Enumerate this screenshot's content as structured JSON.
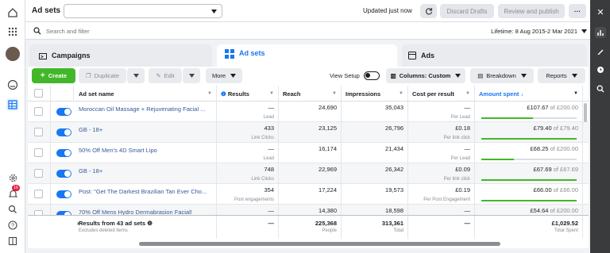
{
  "topbar": {
    "title": "Ad sets",
    "updated": "Updated just now",
    "discard": "Discard Drafts",
    "review": "Review and publish",
    "more": "···"
  },
  "search": {
    "placeholder": "Search and filter",
    "date_range": "Lifetime: 8 Aug 2015-2 Mar 2021"
  },
  "tabs": [
    "Campaigns",
    "Ad sets",
    "Ads"
  ],
  "toolbar": {
    "create": "Create",
    "duplicate": "Duplicate",
    "edit": "Edit",
    "more": "More",
    "view_setup": "View Setup",
    "columns": "Columns: Custom",
    "breakdown": "Breakdown",
    "reports": "Reports"
  },
  "headers": [
    "Ad set name",
    "Results",
    "Reach",
    "Impressions",
    "Cost per result",
    "Amount spent ↓"
  ],
  "rows": [
    {
      "name": "Moroccan Oil Massage + Rejuvenating Facial ...",
      "results": "—",
      "results_sub": "Lead",
      "reach": "24,690",
      "impressions": "35,043",
      "cpr": "—",
      "cpr_sub": "Per Lead",
      "spent": "£107.67",
      "budget": "of £200.00",
      "pct": 0.54
    },
    {
      "name": "GB - 18+",
      "results": "433",
      "results_sub": "Link Clicks",
      "reach": "23,125",
      "impressions": "26,796",
      "cpr": "£0.18",
      "cpr_sub": "Per link click",
      "spent": "£79.40",
      "budget": "of £79.40",
      "pct": 1.0
    },
    {
      "name": "50% Off Men's 4D Smart Lipo",
      "results": "—",
      "results_sub": "Lead",
      "reach": "16,174",
      "impressions": "21,434",
      "cpr": "—",
      "cpr_sub": "Per Lead",
      "spent": "£68.25",
      "budget": "of £200.00",
      "pct": 0.34
    },
    {
      "name": "GB - 18+",
      "results": "748",
      "results_sub": "Link Clicks",
      "reach": "22,969",
      "impressions": "26,342",
      "cpr": "£0.09",
      "cpr_sub": "Per link click",
      "spent": "£67.69",
      "budget": "of £67.69",
      "pct": 1.0
    },
    {
      "name": "Post: \"Get The Darkest Brazilian Tan Ever Cho...",
      "results": "354",
      "results_sub": "Post engagements",
      "reach": "17,224",
      "impressions": "19,573",
      "cpr": "£0.19",
      "cpr_sub": "Per Post Engagement",
      "spent": "£66.00",
      "budget": "of £66.00",
      "pct": 1.0
    },
    {
      "name": "70% Off Mens Hydro Dermabrasion Facial!",
      "results": "—",
      "results_sub": "",
      "reach": "14,380",
      "impressions": "18,598",
      "cpr": "—",
      "cpr_sub": "",
      "spent": "£54.64",
      "budget": "of £200.00",
      "pct": 0.27
    }
  ],
  "footer": {
    "label": "Results from 43 ad sets",
    "sub": "Excludes deleted items",
    "results": "—",
    "reach": "225,368",
    "reach_sub": "People",
    "impressions": "313,361",
    "impressions_sub": "Total",
    "cpr": "—",
    "spent": "£1,029.52",
    "spent_sub": "Total Spent"
  },
  "colors": {
    "accent": "#1877f2",
    "create": "#42b72a",
    "link": "#385898"
  },
  "notification_count": "16"
}
